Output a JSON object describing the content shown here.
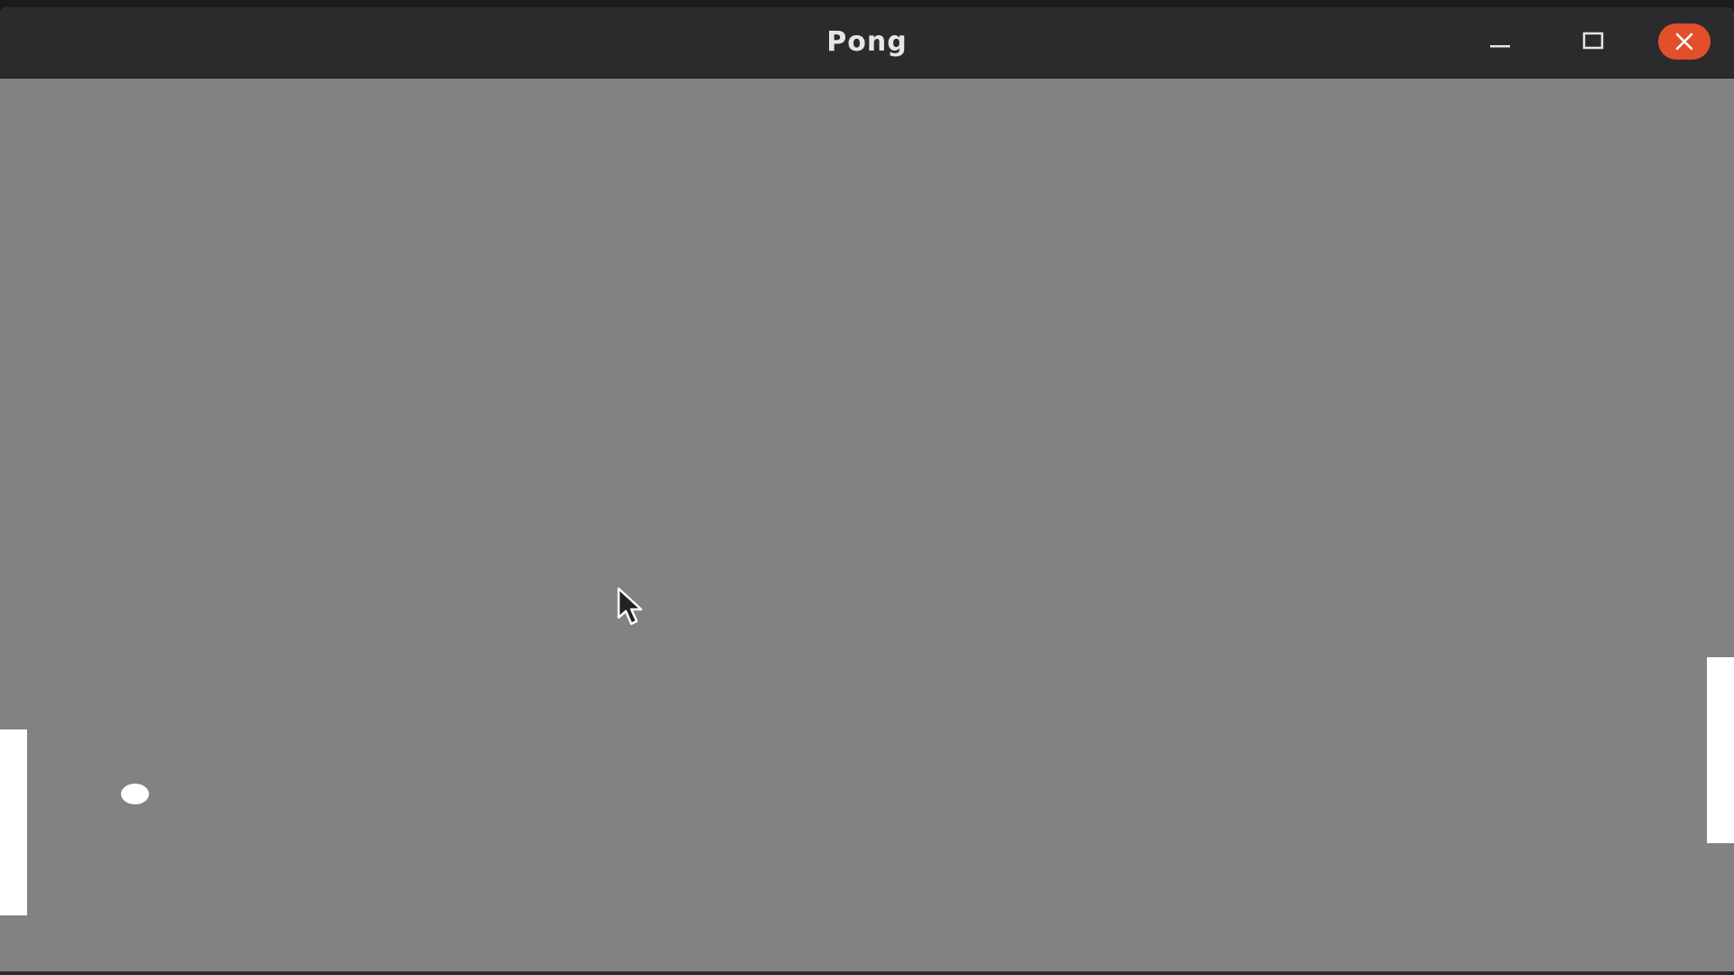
{
  "window": {
    "title": "Pong",
    "buttons": {
      "minimize_icon": "minimize-icon",
      "maximize_icon": "maximize-icon",
      "close_icon": "close-icon"
    },
    "colors": {
      "titlebar": "#2b2b2e",
      "title_text": "#e6e6e6",
      "close_button": "#e1502b"
    }
  },
  "game": {
    "colors": {
      "background": "#828282",
      "paddles": "#ffffff",
      "ball": "#ffffff"
    },
    "objects": [
      "left-paddle",
      "right-paddle",
      "ball"
    ],
    "cursor_icon": "mouse-pointer-icon"
  }
}
